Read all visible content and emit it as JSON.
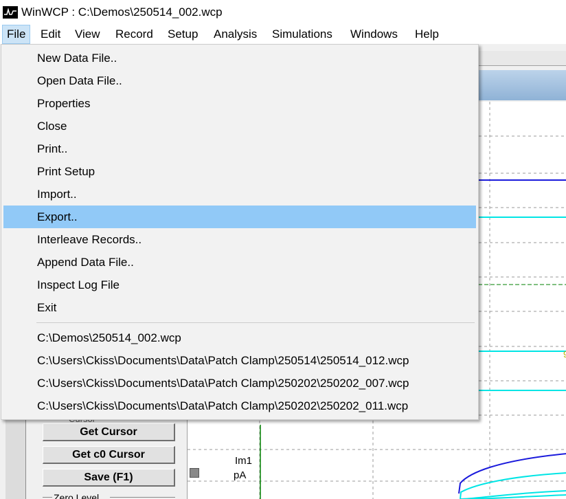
{
  "window": {
    "title": "WinWCP : C:\\Demos\\250514_002.wcp"
  },
  "menubar": {
    "items": [
      {
        "label": "File"
      },
      {
        "label": "Edit"
      },
      {
        "label": "View"
      },
      {
        "label": "Record"
      },
      {
        "label": "Setup"
      },
      {
        "label": "Analysis"
      },
      {
        "label": "Simulations"
      },
      {
        "label": "Windows"
      },
      {
        "label": "Help"
      }
    ]
  },
  "file_menu": {
    "items": [
      {
        "label": "New Data File.."
      },
      {
        "label": "Open Data File.."
      },
      {
        "label": "Properties"
      },
      {
        "label": "Close"
      },
      {
        "label": "Print.."
      },
      {
        "label": "Print Setup"
      },
      {
        "label": "Import.."
      },
      {
        "label": "Export.."
      },
      {
        "label": "Interleave Records.."
      },
      {
        "label": "Append Data File.."
      },
      {
        "label": "Inspect Log File"
      },
      {
        "label": "Exit"
      }
    ],
    "recent_files": [
      {
        "label": "C:\\Demos\\250514_002.wcp"
      },
      {
        "label": "C:\\Users\\Ckiss\\Documents\\Data\\Patch Clamp\\250514\\250514_012.wcp"
      },
      {
        "label": "C:\\Users\\Ckiss\\Documents\\Data\\Patch Clamp\\250202\\250202_007.wcp"
      },
      {
        "label": "C:\\Users\\Ckiss\\Documents\\Data\\Patch Clamp\\250202\\250202_011.wcp"
      }
    ],
    "highlighted": "Export.."
  },
  "side_panel": {
    "cursor_group": "Cursor",
    "get_cursor": "Get Cursor",
    "get_c0_cursor": "Get c0 Cursor",
    "save": "Save (F1)",
    "zero_level": "Zero Level"
  },
  "channel": {
    "name": "Im1",
    "units": "pA",
    "mark": "9"
  },
  "colors": {
    "menu_highlight": "#91c9f7",
    "trace_blue": "#1a1adc",
    "trace_cyan": "#00e5e5",
    "marker_green": "#008000"
  }
}
